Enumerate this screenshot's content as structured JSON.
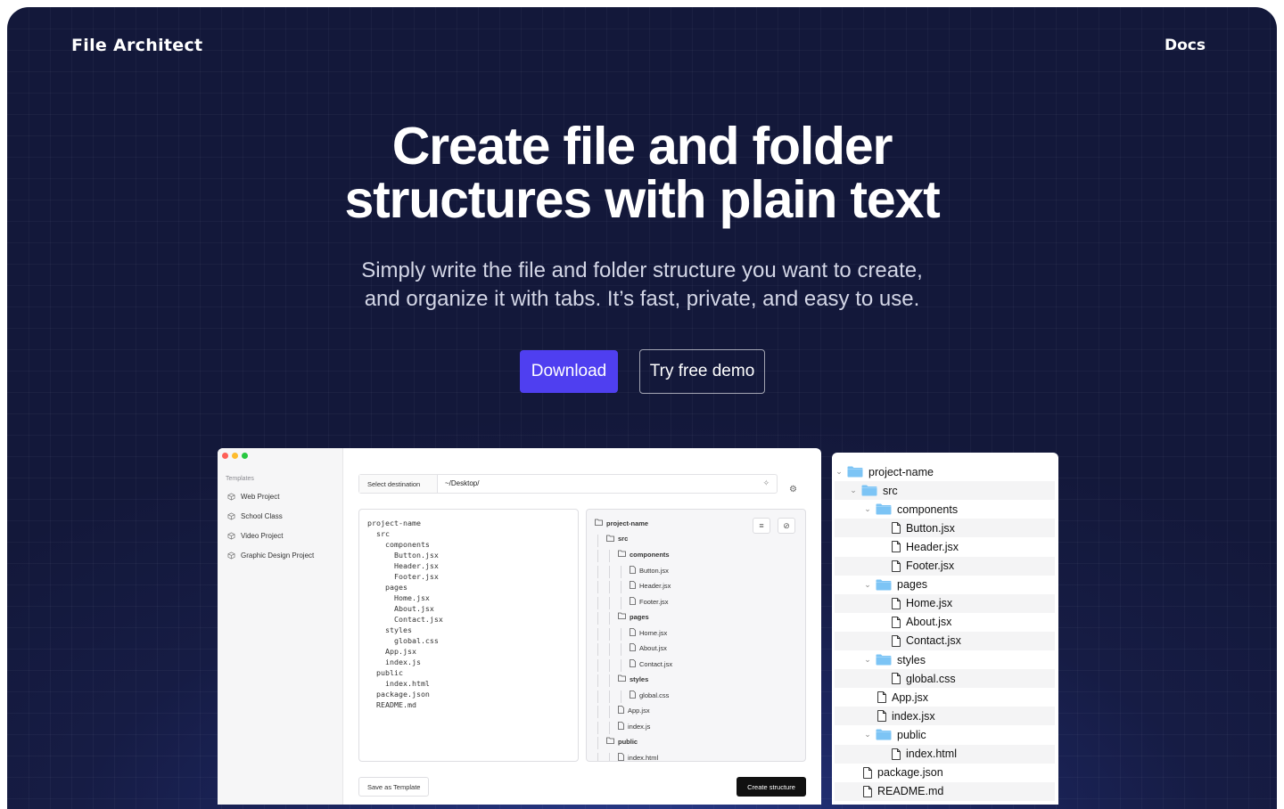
{
  "nav": {
    "brand": "File Architect",
    "docs": "Docs"
  },
  "hero": {
    "title_line1": "Create file and folder",
    "title_line2": "structures with plain text",
    "subtitle_line1": "Simply write the file and folder structure you want to create,",
    "subtitle_line2": "and organize it with tabs. It’s fast, private, and easy to use.",
    "download_label": "Download",
    "demo_label": "Try free demo"
  },
  "app": {
    "sidebar": {
      "title": "Templates",
      "items": [
        "Web Project",
        "School Class",
        "Video Project",
        "Graphic Design Project"
      ]
    },
    "destination_button": "Select destination",
    "destination_path": "~/Desktop/",
    "editor_lines": [
      "project-name",
      "  src",
      "    components",
      "      Button.jsx",
      "      Header.jsx",
      "      Footer.jsx",
      "    pages",
      "      Home.jsx",
      "      About.jsx",
      "      Contact.jsx",
      "    styles",
      "      global.css",
      "    App.jsx",
      "    index.js",
      "  public",
      "    index.html",
      "  package.json",
      "  README.md"
    ],
    "preview_tree": [
      {
        "name": "project-name",
        "type": "folder",
        "depth": 0
      },
      {
        "name": "src",
        "type": "folder",
        "depth": 1
      },
      {
        "name": "components",
        "type": "folder",
        "depth": 2
      },
      {
        "name": "Button.jsx",
        "type": "file",
        "depth": 3
      },
      {
        "name": "Header.jsx",
        "type": "file",
        "depth": 3
      },
      {
        "name": "Footer.jsx",
        "type": "file",
        "depth": 3
      },
      {
        "name": "pages",
        "type": "folder",
        "depth": 2
      },
      {
        "name": "Home.jsx",
        "type": "file",
        "depth": 3
      },
      {
        "name": "About.jsx",
        "type": "file",
        "depth": 3
      },
      {
        "name": "Contact.jsx",
        "type": "file",
        "depth": 3
      },
      {
        "name": "styles",
        "type": "folder",
        "depth": 2
      },
      {
        "name": "global.css",
        "type": "file",
        "depth": 3
      },
      {
        "name": "App.jsx",
        "type": "file",
        "depth": 2
      },
      {
        "name": "index.js",
        "type": "file",
        "depth": 2
      },
      {
        "name": "public",
        "type": "folder",
        "depth": 1
      },
      {
        "name": "index.html",
        "type": "file",
        "depth": 2
      }
    ],
    "save_template_label": "Save as Template",
    "create_label": "Create structure"
  },
  "finder": [
    {
      "name": "project-name",
      "type": "folder",
      "depth": 0,
      "expanded": true
    },
    {
      "name": "src",
      "type": "folder",
      "depth": 1,
      "expanded": true
    },
    {
      "name": "components",
      "type": "folder",
      "depth": 2,
      "expanded": true
    },
    {
      "name": "Button.jsx",
      "type": "file",
      "depth": 3
    },
    {
      "name": "Header.jsx",
      "type": "file",
      "depth": 3
    },
    {
      "name": "Footer.jsx",
      "type": "file",
      "depth": 3
    },
    {
      "name": "pages",
      "type": "folder",
      "depth": 2,
      "expanded": true
    },
    {
      "name": "Home.jsx",
      "type": "file",
      "depth": 3
    },
    {
      "name": "About.jsx",
      "type": "file",
      "depth": 3
    },
    {
      "name": "Contact.jsx",
      "type": "file",
      "depth": 3
    },
    {
      "name": "styles",
      "type": "folder",
      "depth": 2,
      "expanded": true
    },
    {
      "name": "global.css",
      "type": "file",
      "depth": 3
    },
    {
      "name": "App.jsx",
      "type": "file",
      "depth": 2
    },
    {
      "name": "index.jsx",
      "type": "file",
      "depth": 2
    },
    {
      "name": "public",
      "type": "folder",
      "depth": 2,
      "expanded": true
    },
    {
      "name": "index.html",
      "type": "file",
      "depth": 3
    },
    {
      "name": "package.json",
      "type": "file",
      "depth": 1
    },
    {
      "name": "README.md",
      "type": "file",
      "depth": 1
    }
  ],
  "colors": {
    "accent": "#4f3ff0",
    "background": "#161c44",
    "folder": "#7cc4f5"
  }
}
